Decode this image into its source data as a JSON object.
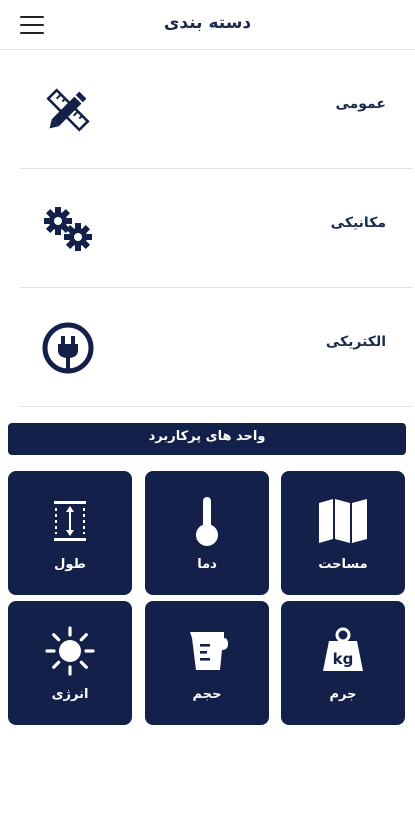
{
  "header": {
    "title": "دسته بندی",
    "menu_icon": "hamburger-menu-icon"
  },
  "categories": [
    {
      "label": "عمومی",
      "icon": "ruler-pencil-icon"
    },
    {
      "label": "مکانیکی",
      "icon": "gears-icon"
    },
    {
      "label": "الکتریکی",
      "icon": "plug-icon"
    }
  ],
  "section": {
    "title": "واحد های پرکاربرد"
  },
  "units": [
    {
      "label": "مساحت",
      "icon": "map-icon"
    },
    {
      "label": "دما",
      "icon": "thermometer-icon"
    },
    {
      "label": "طول",
      "icon": "length-icon"
    },
    {
      "label": "جرم",
      "icon": "weight-kg-icon"
    },
    {
      "label": "حجم",
      "icon": "measuring-cup-icon"
    },
    {
      "label": "انرژی",
      "icon": "sun-icon"
    }
  ],
  "colors": {
    "primary": "#13214a",
    "text": "#1a2a4f",
    "divider": "#e2e2e2",
    "background": "#ffffff"
  },
  "icon_text": {
    "weight_badge": "kg"
  }
}
